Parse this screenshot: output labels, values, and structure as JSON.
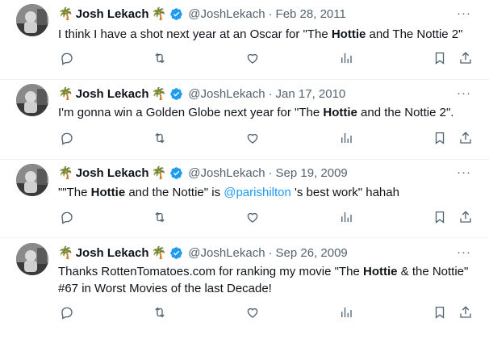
{
  "tweets": [
    {
      "name": "Josh Lekach",
      "handle": "@JoshLekach",
      "separator": "·",
      "date": "Feb 28, 2011",
      "text": {
        "pre": "I think I have a shot next year at an Oscar for \"The ",
        "bold": "Hottie",
        "post": " and The Nottie 2\""
      }
    },
    {
      "name": "Josh Lekach",
      "handle": "@JoshLekach",
      "separator": "·",
      "date": "Jan 17, 2010",
      "text": {
        "pre": "I'm gonna win a Golden Globe next year for \"The ",
        "bold": "Hottie",
        "post": " and the Nottie 2\"."
      }
    },
    {
      "name": "Josh Lekach",
      "handle": "@JoshLekach",
      "separator": "·",
      "date": "Sep 19, 2009",
      "text": {
        "pre": "\"\"The ",
        "bold": "Hottie",
        "mid": " and the Nottie\" is ",
        "mention": "@parishilton",
        "post": " 's best work\" hahah"
      }
    },
    {
      "name": "Josh Lekach",
      "handle": "@JoshLekach",
      "separator": "·",
      "date": "Sep 26, 2009",
      "text": {
        "pre": "Thanks RottenTomatoes.com for ranking my movie \"The ",
        "bold": "Hottie",
        "post": " & the Nottie\" #67 in Worst Movies of the last Decade!"
      }
    }
  ],
  "emoji": "🌴",
  "more_label": "···",
  "icons": {
    "reply": "reply-icon",
    "retweet": "retweet-icon",
    "like": "like-icon",
    "views": "views-icon",
    "bookmark": "bookmark-icon",
    "share": "share-icon",
    "verified": "verified-badge-icon"
  },
  "colors": {
    "text": "#0f1419",
    "muted": "#536471",
    "link": "#1d9bf0",
    "verified": "#1d9bf0",
    "divider": "#eff3f4"
  }
}
